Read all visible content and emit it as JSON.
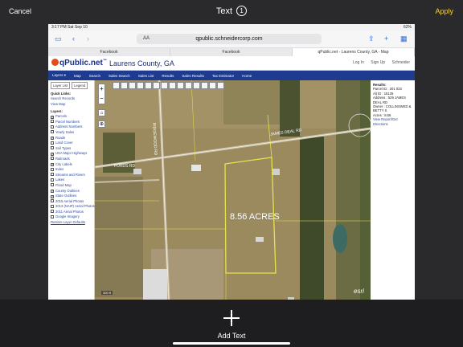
{
  "editor": {
    "cancel_label": "Cancel",
    "apply_label": "Apply",
    "title": "Text",
    "title_badge": "1",
    "add_text_label": "Add Text"
  },
  "device": {
    "time": "3:17 PM",
    "date": "Sat Sep 10",
    "battery": "62%"
  },
  "safari": {
    "aa": "AA",
    "url": "qpublic.schneidercorp.com",
    "tabs": [
      "Facebook",
      "Facebook",
      "qPublic.net - Laurens County, GA - Map"
    ]
  },
  "site": {
    "logo": "qPublic.net",
    "tm": "™",
    "county": "Laurens County, GA",
    "header_links": [
      "Log In",
      "Sign Up",
      "Schneider"
    ],
    "nav": [
      "Layers ▾",
      "Map",
      "Search",
      "Sales Search",
      "Sales List",
      "Results",
      "Sales Results",
      "Tax Estimator",
      "Home"
    ]
  },
  "sidebar": {
    "tabs": [
      "Layer List",
      "Legend"
    ],
    "quick_links_heading": "Quick Links:",
    "quick_links": [
      "Search Records",
      "View Map"
    ],
    "layers_heading": "Layers:",
    "layers": [
      {
        "label": "Parcels",
        "checked": true
      },
      {
        "label": "Parcel Numbers",
        "checked": false
      },
      {
        "label": "Address Numbers",
        "checked": false
      },
      {
        "label": "Yearly Sales",
        "checked": false
      },
      {
        "label": "Roads",
        "checked": true
      },
      {
        "label": "Land Cover",
        "checked": false
      },
      {
        "label": "Soil Types",
        "checked": false
      },
      {
        "label": "USA Major Highways",
        "checked": true
      },
      {
        "label": "Railroads",
        "checked": false
      },
      {
        "label": "City Labels",
        "checked": true
      },
      {
        "label": "Index",
        "checked": false
      },
      {
        "label": "Streams and Rivers",
        "checked": false
      },
      {
        "label": "Lakes",
        "checked": false
      },
      {
        "label": "Flood Map",
        "checked": false
      },
      {
        "label": "County Outlines",
        "checked": true
      },
      {
        "label": "State Outlines",
        "checked": true
      },
      {
        "label": "2015 Aerial Photos",
        "checked": false
      },
      {
        "label": "2013 (NAIP) Aerial Photos",
        "checked": false
      },
      {
        "label": "2011 Aerial Photos",
        "checked": false
      },
      {
        "label": "Google Imagery",
        "checked": false
      }
    ],
    "restore_label": "Restore Layer Defaults"
  },
  "map": {
    "acreage_label": "8.56 ACRES",
    "road_labels": [
      "JAMES DEAL RD",
      "RIDGEWOOD RD",
      "FORDS RD"
    ],
    "watermark": "esri",
    "scale": "300 ft"
  },
  "results": {
    "heading": "Results:",
    "parcel_id": "Parcel ID : 201 023",
    "alt_id": "Alt ID : 15125",
    "address": "Address : 529 JAMES DEAL RD",
    "owner": "Owner : COLLINSWED & BETTY S",
    "acres": "Acres : 8.56",
    "link": "View Report/Get Directions"
  }
}
